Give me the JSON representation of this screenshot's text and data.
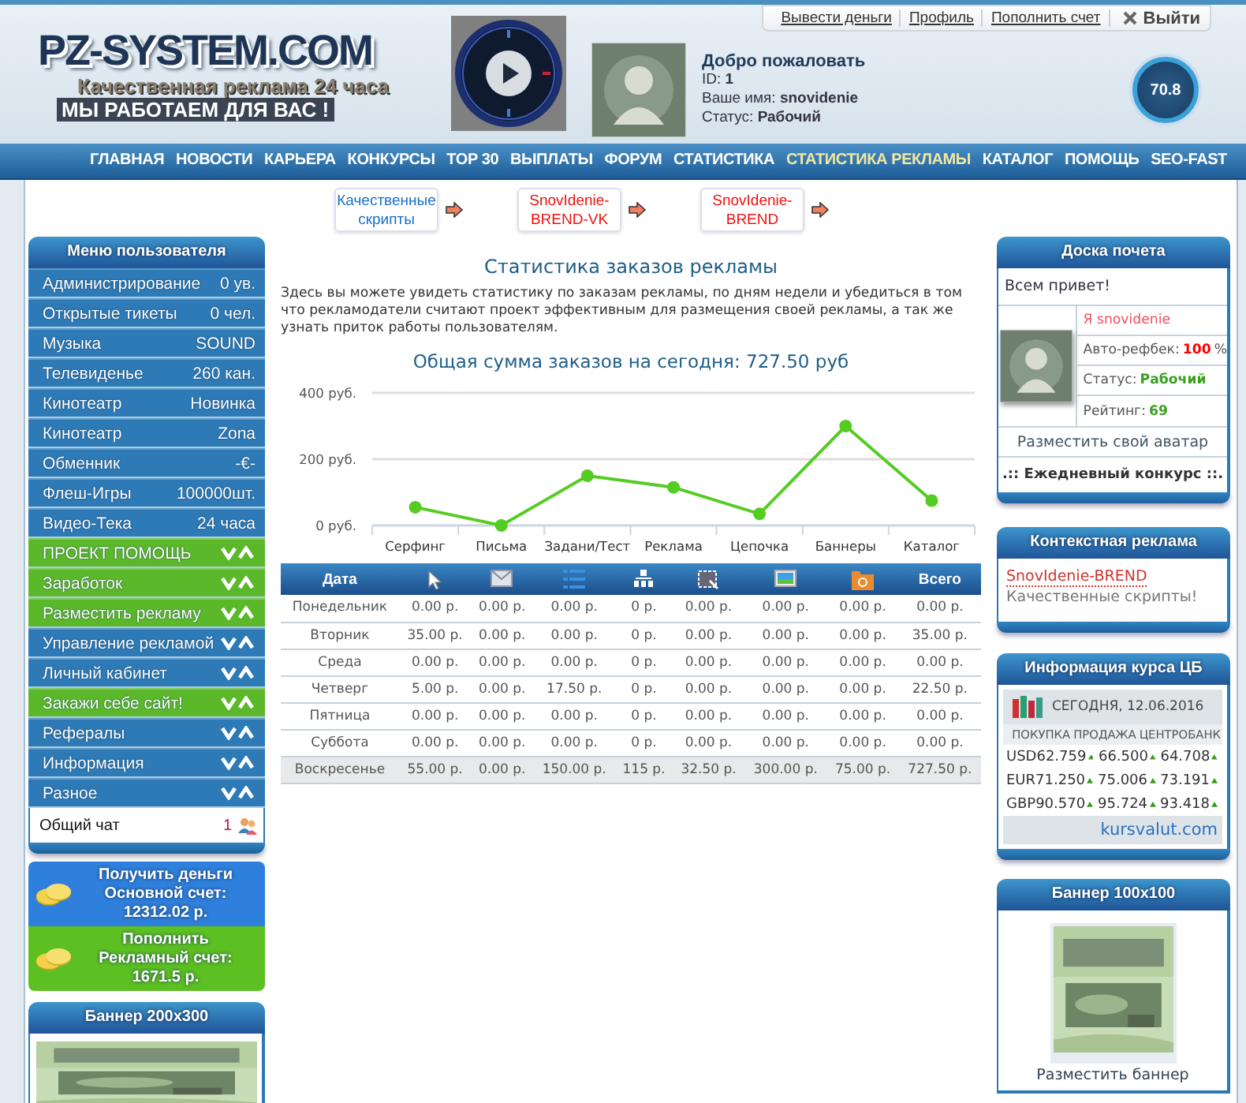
{
  "header": {
    "logo": "PZ-SYSTEM.COM",
    "slogan": "Качественная реклама 24 часа",
    "motto": "МЫ РАБОТАЕМ ДЛЯ ВАС !",
    "top_links": [
      "Вывести деньги",
      "Профиль",
      "Пополнить счет"
    ],
    "logout": "Выйти",
    "user": {
      "greeting": "Добро пожаловать",
      "lines": [
        "ID: **1**",
        "Ваше имя: **snovidenie**",
        "Статус: **Рабочий**"
      ]
    },
    "rating": "70.8"
  },
  "nav": [
    {
      "label": "ГЛАВНАЯ",
      "selected": false
    },
    {
      "label": "НОВОСТИ",
      "selected": false
    },
    {
      "label": "КАРЬЕРА",
      "selected": false
    },
    {
      "label": "КОНКУРСЫ",
      "selected": false
    },
    {
      "label": "TOP 30",
      "selected": false
    },
    {
      "label": "ВЫПЛАТЫ",
      "selected": false
    },
    {
      "label": "ФОРУМ",
      "selected": false
    },
    {
      "label": "СТАТИСТИКА",
      "selected": false
    },
    {
      "label": "СТАТИСТИКА РЕКЛАМЫ",
      "selected": true
    },
    {
      "label": "КАТАЛОГ",
      "selected": false
    },
    {
      "label": "ПОМОЩЬ",
      "selected": false
    },
    {
      "label": "SEO-FAST",
      "selected": false
    }
  ],
  "promo_links": [
    {
      "text": "Качественные скрипты",
      "color": "#1a6fc8"
    },
    {
      "text": "SnovIdenie-BREND-VK",
      "color": "#ee1111"
    },
    {
      "text": "SnovIdenie-BREND",
      "color": "#ee1111"
    }
  ],
  "user_menu": {
    "title": "Меню пользователя",
    "items": [
      {
        "kind": "info",
        "label": "Администрирование",
        "value": "0 ув.",
        "color": "#2d7ab6"
      },
      {
        "kind": "info",
        "label": "Открытые тикеты",
        "value": "0 чел.",
        "color": "#2d7ab6"
      },
      {
        "kind": "info",
        "label": "Музыка",
        "value": "SOUND",
        "color": "#2d7ab6"
      },
      {
        "kind": "info",
        "label": "Телевиденье",
        "value": "260 кан.",
        "color": "#2d7ab6"
      },
      {
        "kind": "info",
        "label": "Кинотеатр",
        "value": "Новинка",
        "color": "#2d7ab6"
      },
      {
        "kind": "info",
        "label": "Кинотеатр",
        "value": "Zona",
        "color": "#2d7ab6"
      },
      {
        "kind": "info",
        "label": "Обменник",
        "value": "-€-",
        "color": "#2d7ab6"
      },
      {
        "kind": "info",
        "label": "Флеш-Игры",
        "value": "100000шт.",
        "color": "#2d7ab6"
      },
      {
        "kind": "info",
        "label": "Видео-Тека",
        "value": "24 часа",
        "color": "#2d7ab6"
      },
      {
        "kind": "section",
        "label": "ПРОЕКТ ПОМОЩЬ",
        "color": "#5bb82a"
      },
      {
        "kind": "section",
        "label": "Заработок",
        "color": "#5bb82a"
      },
      {
        "kind": "section",
        "label": "Разместить рекламу",
        "color": "#5bb82a"
      },
      {
        "kind": "section",
        "label": "Управление рекламой",
        "color": "#2d7ab6"
      },
      {
        "kind": "section",
        "label": "Личный кабинет",
        "color": "#2d7ab6"
      },
      {
        "kind": "section",
        "label": "Закажи себе сайт!",
        "color": "#5bb82a"
      },
      {
        "kind": "section",
        "label": "Рефералы",
        "color": "#2d7ab6"
      },
      {
        "kind": "section",
        "label": "Информация",
        "color": "#2d7ab6"
      },
      {
        "kind": "section",
        "label": "Разное",
        "color": "#2d7ab6"
      }
    ],
    "chat": {
      "label": "Общий чат",
      "count": "1"
    }
  },
  "money": [
    {
      "title": "Получить деньги",
      "account": "Основной счет: 12312.02 р.",
      "color": "#2f7fdc"
    },
    {
      "title": "Пополнить",
      "account": "Рекламный счет: 1671.5 р.",
      "color": "#5cbf22"
    }
  ],
  "banner_left": {
    "title": "Баннер 200x300"
  },
  "stats": {
    "title": "Статистика заказов рекламы",
    "intro": "Здесь вы можете увидеть статистику по заказам рекламы, по дням недели и убедиться в том что рекламодатели считают проект эффективным для размещения своей рекламы, а так же узнать приток работы пользователям.",
    "total": "Общая сумма заказов на сегодня: 727.50 руб",
    "chart_data": {
      "type": "line",
      "categories": [
        "Серфинг",
        "Письма",
        "Задани/Тест",
        "Реклама",
        "Цепочка",
        "Баннеры",
        "Каталог"
      ],
      "series": [
        {
          "color": "#55cc22",
          "marker": true,
          "values": [
            55,
            0,
            150,
            115,
            35,
            300,
            75
          ]
        }
      ],
      "ylim": [
        0,
        400
      ],
      "yticks": [
        {
          "value": 0,
          "label": "0 руб."
        },
        {
          "value": 200,
          "label": "200 руб."
        },
        {
          "value": 400,
          "label": "400 руб."
        }
      ]
    },
    "table": {
      "columns": [
        {
          "kind": "text",
          "label": "Дата"
        },
        {
          "kind": "icon"
        },
        {
          "kind": "icon"
        },
        {
          "kind": "icon"
        },
        {
          "kind": "icon"
        },
        {
          "kind": "icon"
        },
        {
          "kind": "icon"
        },
        {
          "kind": "icon"
        },
        {
          "kind": "text",
          "label": "Всего"
        }
      ],
      "rows": [
        {
          "highlighted": false,
          "cells": [
            "Понедельник",
            "0.00 р.",
            "0.00 р.",
            "0.00 р.",
            "0 р.",
            "0.00 р.",
            "0.00 р.",
            "0.00 р.",
            "0.00 р."
          ]
        },
        {
          "highlighted": false,
          "cells": [
            "Вторник",
            "35.00 р.",
            "0.00 р.",
            "0.00 р.",
            "0 р.",
            "0.00 р.",
            "0.00 р.",
            "0.00 р.",
            "35.00 р."
          ]
        },
        {
          "highlighted": false,
          "cells": [
            "Среда",
            "0.00 р.",
            "0.00 р.",
            "0.00 р.",
            "0 р.",
            "0.00 р.",
            "0.00 р.",
            "0.00 р.",
            "0.00 р."
          ]
        },
        {
          "highlighted": false,
          "cells": [
            "Четверг",
            "5.00 р.",
            "0.00 р.",
            "17.50 р.",
            "0 р.",
            "0.00 р.",
            "0.00 р.",
            "0.00 р.",
            "22.50 р."
          ]
        },
        {
          "highlighted": false,
          "cells": [
            "Пятница",
            "0.00 р.",
            "0.00 р.",
            "0.00 р.",
            "0 р.",
            "0.00 р.",
            "0.00 р.",
            "0.00 р.",
            "0.00 р."
          ]
        },
        {
          "highlighted": false,
          "cells": [
            "Суббота",
            "0.00 р.",
            "0.00 р.",
            "0.00 р.",
            "0 р.",
            "0.00 р.",
            "0.00 р.",
            "0.00 р.",
            "0.00 р."
          ]
        },
        {
          "highlighted": true,
          "cells": [
            "Воскресенье",
            "55.00 р.",
            "0.00 р.",
            "150.00 р.",
            "115 р.",
            "32.50 р.",
            "300.00 р.",
            "75.00 р.",
            "727.50 р."
          ]
        }
      ]
    }
  },
  "honor_board": {
    "title": "Доска почета",
    "greeting": "Всем привет!",
    "name": "Я snovidenie",
    "facts": [
      {
        "label": "Авто-рефбек:",
        "value": "100",
        "unit": "%",
        "color": "#ff0000"
      },
      {
        "label": "Статус:",
        "value": "Рабочий",
        "color": "#3aa020"
      },
      {
        "label": "Рейтинг:",
        "value": "69",
        "color": "#3aa020"
      }
    ],
    "avatar_link": "Разместить свой аватар",
    "contest": ".:: Ежедневный конкурс ::."
  },
  "context_ads": {
    "title": "Контекстная реклама",
    "link": "SnovIdenie-BREND",
    "text": "Качественные скрипты!"
  },
  "rates": {
    "title": "Информация курса ЦБ",
    "date": "СЕГОДНЯ, 12.06.2016",
    "columns": [
      "ПОКУПКА",
      "ПРОДАЖА",
      "ЦЕНТРОБАНК"
    ],
    "rows": [
      {
        "currency": "USD",
        "values": [
          "62.759",
          "66.500",
          "64.708"
        ]
      },
      {
        "currency": "EUR",
        "values": [
          "71.250",
          "75.006",
          "73.191"
        ]
      },
      {
        "currency": "GBP",
        "values": [
          "90.570",
          "95.724",
          "93.418"
        ]
      }
    ],
    "source": "kursvalut.com"
  },
  "banner_right": {
    "title": "Баннер 100x100",
    "link": "Разместить баннер"
  }
}
